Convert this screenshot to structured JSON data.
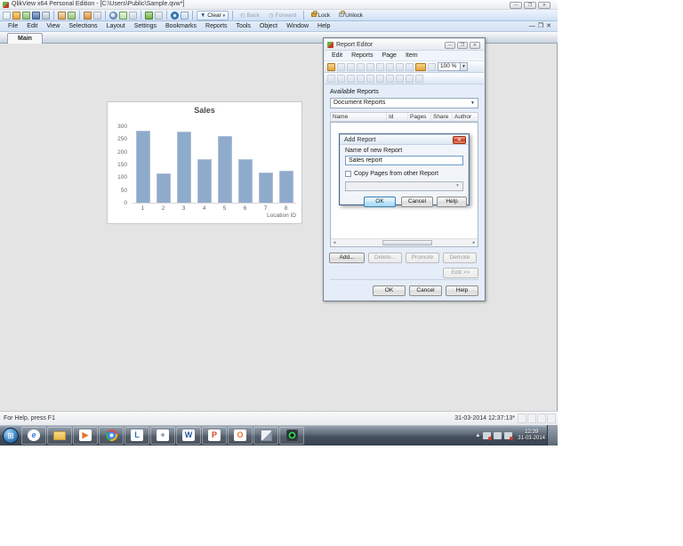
{
  "window": {
    "title": "QlikView x64 Personal Edition - [C:\\Users\\Public\\Sample.qvw*]"
  },
  "toolbar": {
    "clear_label": "Clear",
    "back_label": "Back",
    "forward_label": "Forward",
    "lock_label": "Lock",
    "unlock_label": "Unlock",
    "icons": [
      "new-document-icon",
      "open-icon",
      "refresh-icon",
      "save-icon",
      "print-icon",
      "edit-icon",
      "reload-icon",
      "undo-icon",
      "redo-icon",
      "search-icon",
      "current-selections-icon",
      "quick-change-icon",
      "favorites-icon",
      "design-grid-icon",
      "help-icon",
      "whats-this-icon"
    ]
  },
  "menubar": {
    "items": [
      "File",
      "Edit",
      "View",
      "Selections",
      "Layout",
      "Settings",
      "Bookmarks",
      "Reports",
      "Tools",
      "Object",
      "Window",
      "Help"
    ]
  },
  "tabs": {
    "main": "Main"
  },
  "chart_data": {
    "type": "bar",
    "title": "Sales",
    "categories": [
      "1",
      "2",
      "3",
      "4",
      "5",
      "6",
      "7",
      "8"
    ],
    "values": [
      285,
      115,
      282,
      173,
      263,
      172,
      120,
      128
    ],
    "xlabel": "Location ID",
    "ylabel": "",
    "ylim": [
      0,
      300
    ],
    "yticks": [
      0,
      50,
      100,
      150,
      200,
      250,
      300
    ],
    "bar_color": "#8fabcb",
    "legend": "none",
    "grid": "off"
  },
  "report_editor": {
    "title": "Report Editor",
    "menu": [
      "Edit",
      "Reports",
      "Page",
      "Item"
    ],
    "zoom_value": "100 %",
    "available_reports_label": "Available Reports",
    "reports_combo_value": "Document Reports",
    "table_headers": [
      "Name",
      "Id",
      "Pages",
      "Share",
      "Author"
    ],
    "buttons": {
      "add": "Add...",
      "delete": "Delete...",
      "promote": "Promote",
      "demote": "Demote",
      "edit": "Edit >>",
      "ok": "OK",
      "cancel": "Cancel",
      "help": "Help"
    }
  },
  "add_report": {
    "title": "Add Report",
    "name_label": "Name of new Report",
    "name_value": "Sales report",
    "copy_checkbox_label": "Copy Pages from other Report",
    "checkbox_checked": false,
    "buttons": {
      "ok": "OK",
      "cancel": "Cancel",
      "help": "Help"
    }
  },
  "status_bar": {
    "left": "For Help, press F1",
    "right": "31-03-2014 12:37:13*"
  },
  "taskbar": {
    "pinned": [
      "start-orb",
      "internet-explorer",
      "windows-explorer",
      "media-player",
      "chrome",
      "launcher-l",
      "picture-tool",
      "word",
      "powerpoint",
      "outlook",
      "journal",
      "webcam-app"
    ],
    "tray_icons": [
      "network-error-icon",
      "printer-icon",
      "volume-muted-icon"
    ],
    "clock_time": "12:39",
    "clock_date": "31-03-2014"
  },
  "colors": {
    "bar_fill": "#8fabcb",
    "toolbar_blue": "#cfe0f6",
    "taskbar_dark": "#47525f",
    "dialog_frame": "#4e698c",
    "default_button_border": "#3c7fb1",
    "close_button_red": "#c13b22"
  }
}
